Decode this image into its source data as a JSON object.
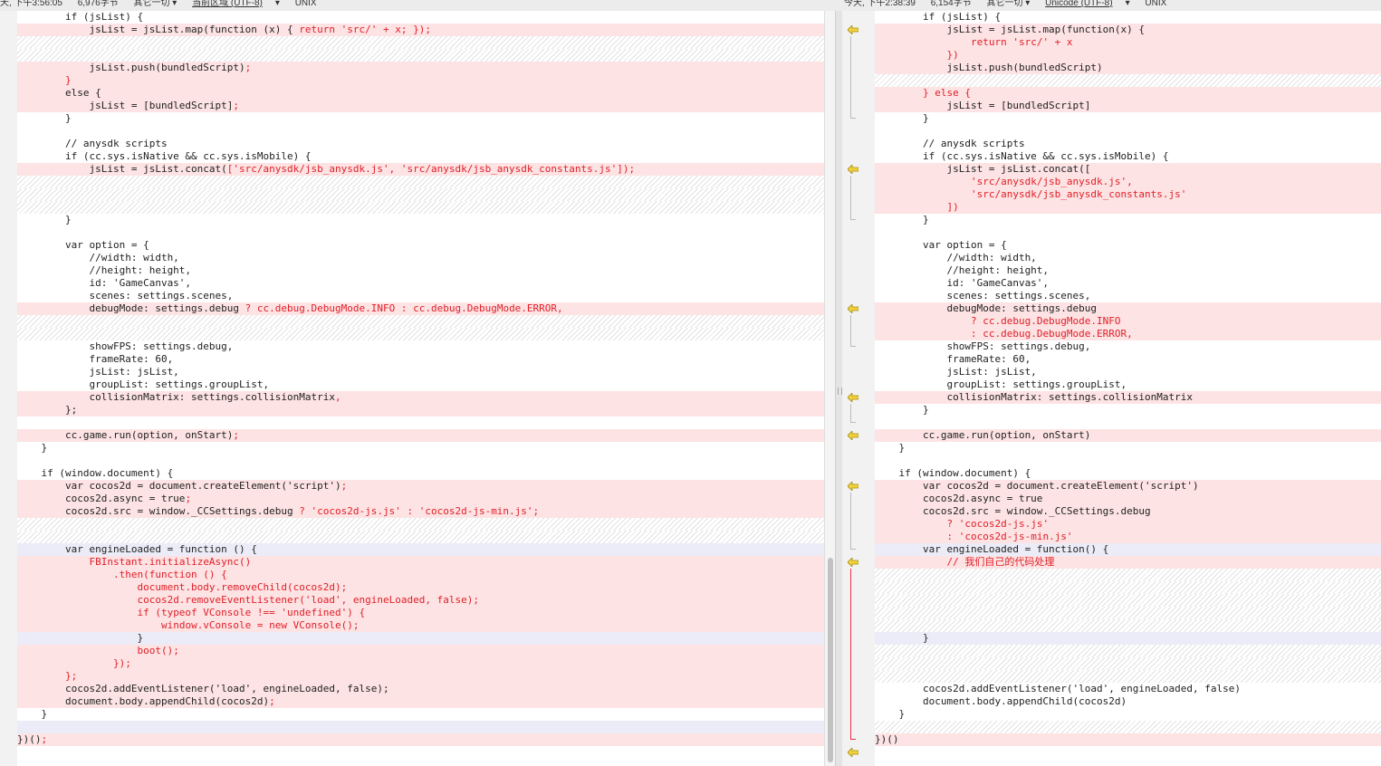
{
  "status_left": {
    "time": "天, 下午3:56:05",
    "chars": "6,976字节",
    "other": "其它一切 ▾",
    "encoding": "当前区域 (UTF-8)",
    "encoding_arrow": "▾",
    "line_ending": "UNIX"
  },
  "status_right": {
    "time": "今天, 下午2:38:39",
    "chars": "6,154字节",
    "other": "其它一切 ▾",
    "encoding": "Unicode (UTF-8)",
    "encoding_arrow": "▾",
    "line_ending": "UNIX"
  },
  "colors": {
    "deleted_bg": "#fde3e3",
    "changed_text": "#e0202a",
    "blue_bg": "#ececf8",
    "arrow": "#f1d23a"
  },
  "icons": {
    "merge_arrow": "merge-left-arrow-icon"
  },
  "left_lines": [
    {
      "t": "n",
      "s": [
        [
          "        if (jsList) {",
          0
        ]
      ]
    },
    {
      "t": "d",
      "s": [
        [
          "            jsList = jsList.map(function (x) { ",
          0
        ],
        [
          "return 'src/' + x; });",
          1
        ]
      ]
    },
    {
      "t": "b",
      "s": []
    },
    {
      "t": "b",
      "s": []
    },
    {
      "t": "d",
      "s": [
        [
          "            jsList.push(bundledScript)",
          0
        ],
        [
          ";",
          1
        ]
      ]
    },
    {
      "t": "d",
      "s": [
        [
          "        ",
          0
        ],
        [
          "}",
          1
        ]
      ]
    },
    {
      "t": "d",
      "s": [
        [
          "        else {",
          0
        ]
      ]
    },
    {
      "t": "d",
      "s": [
        [
          "            jsList = [bundledScript]",
          0
        ],
        [
          ";",
          1
        ]
      ]
    },
    {
      "t": "n",
      "s": [
        [
          "        }",
          0
        ]
      ]
    },
    {
      "t": "n",
      "s": [
        [
          "",
          0
        ]
      ]
    },
    {
      "t": "n",
      "s": [
        [
          "        // anysdk scripts",
          0
        ]
      ]
    },
    {
      "t": "n",
      "s": [
        [
          "        if (cc.sys.isNative && cc.sys.isMobile) {",
          0
        ]
      ]
    },
    {
      "t": "d",
      "s": [
        [
          "            jsList = jsList.concat(",
          0
        ],
        [
          "['src/anysdk/jsb_anysdk.js', 'src/anysdk/jsb_anysdk_constants.js']);",
          1
        ]
      ]
    },
    {
      "t": "b",
      "s": []
    },
    {
      "t": "b",
      "s": []
    },
    {
      "t": "b",
      "s": []
    },
    {
      "t": "n",
      "s": [
        [
          "        }",
          0
        ]
      ]
    },
    {
      "t": "n",
      "s": [
        [
          "",
          0
        ]
      ]
    },
    {
      "t": "n",
      "s": [
        [
          "        var option = {",
          0
        ]
      ]
    },
    {
      "t": "n",
      "s": [
        [
          "            //width: width,",
          0
        ]
      ]
    },
    {
      "t": "n",
      "s": [
        [
          "            //height: height,",
          0
        ]
      ]
    },
    {
      "t": "n",
      "s": [
        [
          "            id: 'GameCanvas',",
          0
        ]
      ]
    },
    {
      "t": "n",
      "s": [
        [
          "            scenes: settings.scenes,",
          0
        ]
      ]
    },
    {
      "t": "d",
      "s": [
        [
          "            debugMode: settings.debug ",
          0
        ],
        [
          "? cc.debug.DebugMode.INFO : cc.debug.DebugMode.ERROR,",
          1
        ]
      ]
    },
    {
      "t": "b",
      "s": []
    },
    {
      "t": "b",
      "s": []
    },
    {
      "t": "n",
      "s": [
        [
          "            showFPS: settings.debug,",
          0
        ]
      ]
    },
    {
      "t": "n",
      "s": [
        [
          "            frameRate: 60,",
          0
        ]
      ]
    },
    {
      "t": "n",
      "s": [
        [
          "            jsList: jsList,",
          0
        ]
      ]
    },
    {
      "t": "n",
      "s": [
        [
          "            groupList: settings.groupList,",
          0
        ]
      ]
    },
    {
      "t": "d",
      "s": [
        [
          "            collisionMatrix: settings.collisionMatrix",
          0
        ],
        [
          ",",
          1
        ]
      ]
    },
    {
      "t": "d",
      "s": [
        [
          "        };",
          0
        ]
      ]
    },
    {
      "t": "n",
      "s": [
        [
          "",
          0
        ]
      ]
    },
    {
      "t": "d",
      "s": [
        [
          "        cc.game.run(option, onStart)",
          0
        ],
        [
          ";",
          1
        ]
      ]
    },
    {
      "t": "n",
      "s": [
        [
          "    }",
          0
        ]
      ]
    },
    {
      "t": "n",
      "s": [
        [
          "",
          0
        ]
      ]
    },
    {
      "t": "n",
      "s": [
        [
          "    if (window.document) {",
          0
        ]
      ]
    },
    {
      "t": "d",
      "s": [
        [
          "        var cocos2d = document.createElement('script')",
          0
        ],
        [
          ";",
          1
        ]
      ]
    },
    {
      "t": "d",
      "s": [
        [
          "        cocos2d.async = true",
          0
        ],
        [
          ";",
          1
        ]
      ]
    },
    {
      "t": "d",
      "s": [
        [
          "        cocos2d.src = window._CCSettings.debug ",
          0
        ],
        [
          "? 'cocos2d-js.js' : 'cocos2d-js-min.js';",
          1
        ]
      ]
    },
    {
      "t": "b",
      "s": []
    },
    {
      "t": "b",
      "s": []
    },
    {
      "t": "u",
      "s": [
        [
          "        var engineLoaded = function () {",
          0
        ]
      ]
    },
    {
      "t": "d",
      "s": [
        [
          "            ",
          0
        ],
        [
          "FBInstant.initializeAsync()",
          1
        ]
      ]
    },
    {
      "t": "d",
      "s": [
        [
          "                ",
          0
        ],
        [
          ".then(function () {",
          1
        ]
      ]
    },
    {
      "t": "d",
      "s": [
        [
          "                    ",
          0
        ],
        [
          "document.body.removeChild(cocos2d);",
          1
        ]
      ]
    },
    {
      "t": "d",
      "s": [
        [
          "                    ",
          0
        ],
        [
          "cocos2d.removeEventListener('load', engineLoaded, false);",
          1
        ]
      ]
    },
    {
      "t": "d",
      "s": [
        [
          "                    ",
          0
        ],
        [
          "if (typeof VConsole !== 'undefined') {",
          1
        ]
      ]
    },
    {
      "t": "d",
      "s": [
        [
          "                        ",
          0
        ],
        [
          "window.vConsole = new VConsole();",
          1
        ]
      ]
    },
    {
      "t": "u",
      "s": [
        [
          "                    }",
          0
        ]
      ]
    },
    {
      "t": "d",
      "s": [
        [
          "                    ",
          0
        ],
        [
          "boot();",
          1
        ]
      ]
    },
    {
      "t": "d",
      "s": [
        [
          "                ",
          0
        ],
        [
          "});",
          1
        ]
      ]
    },
    {
      "t": "d",
      "s": [
        [
          "        ",
          0
        ],
        [
          "};",
          1
        ]
      ]
    },
    {
      "t": "d",
      "s": [
        [
          "        cocos2d.addEventListener('load', engineLoaded, false);",
          0
        ]
      ]
    },
    {
      "t": "d",
      "s": [
        [
          "        document.body.appendChild(cocos2d)",
          0
        ],
        [
          ";",
          1
        ]
      ]
    },
    {
      "t": "n",
      "s": [
        [
          "    }",
          0
        ]
      ]
    },
    {
      "t": "u",
      "s": [
        [
          "",
          0
        ]
      ]
    },
    {
      "t": "d",
      "s": [
        [
          "})()",
          0
        ],
        [
          ";",
          1
        ]
      ]
    },
    {
      "t": "n",
      "s": [
        [
          "",
          0
        ]
      ]
    }
  ],
  "right_lines": [
    {
      "t": "n",
      "s": [
        [
          "        if (jsList) {",
          0
        ]
      ]
    },
    {
      "t": "d",
      "s": [
        [
          "            jsList = jsList.map(function(x) {",
          0
        ]
      ]
    },
    {
      "t": "d",
      "s": [
        [
          "                ",
          0
        ],
        [
          "return 'src/' + x",
          1
        ]
      ]
    },
    {
      "t": "d",
      "s": [
        [
          "            ",
          0
        ],
        [
          "})",
          1
        ]
      ]
    },
    {
      "t": "d",
      "s": [
        [
          "            jsList.push(bundledScript)",
          0
        ]
      ]
    },
    {
      "t": "b",
      "s": []
    },
    {
      "t": "d",
      "s": [
        [
          "        ",
          0
        ],
        [
          "} else {",
          1
        ]
      ]
    },
    {
      "t": "d",
      "s": [
        [
          "            jsList = [bundledScript]",
          0
        ]
      ]
    },
    {
      "t": "n",
      "s": [
        [
          "        }",
          0
        ]
      ]
    },
    {
      "t": "n",
      "s": [
        [
          "",
          0
        ]
      ]
    },
    {
      "t": "n",
      "s": [
        [
          "        // anysdk scripts",
          0
        ]
      ]
    },
    {
      "t": "n",
      "s": [
        [
          "        if (cc.sys.isNative && cc.sys.isMobile) {",
          0
        ]
      ]
    },
    {
      "t": "d",
      "s": [
        [
          "            jsList = jsList.concat([",
          0
        ]
      ]
    },
    {
      "t": "d",
      "s": [
        [
          "                ",
          0
        ],
        [
          "'src/anysdk/jsb_anysdk.js',",
          1
        ]
      ]
    },
    {
      "t": "d",
      "s": [
        [
          "                ",
          0
        ],
        [
          "'src/anysdk/jsb_anysdk_constants.js'",
          1
        ]
      ]
    },
    {
      "t": "d",
      "s": [
        [
          "            ",
          0
        ],
        [
          "])",
          1
        ]
      ]
    },
    {
      "t": "n",
      "s": [
        [
          "        }",
          0
        ]
      ]
    },
    {
      "t": "n",
      "s": [
        [
          "",
          0
        ]
      ]
    },
    {
      "t": "n",
      "s": [
        [
          "        var option = {",
          0
        ]
      ]
    },
    {
      "t": "n",
      "s": [
        [
          "            //width: width,",
          0
        ]
      ]
    },
    {
      "t": "n",
      "s": [
        [
          "            //height: height,",
          0
        ]
      ]
    },
    {
      "t": "n",
      "s": [
        [
          "            id: 'GameCanvas',",
          0
        ]
      ]
    },
    {
      "t": "n",
      "s": [
        [
          "            scenes: settings.scenes,",
          0
        ]
      ]
    },
    {
      "t": "d",
      "s": [
        [
          "            debugMode: settings.debug",
          0
        ]
      ]
    },
    {
      "t": "d",
      "s": [
        [
          "                ",
          0
        ],
        [
          "? cc.debug.DebugMode.INFO",
          1
        ]
      ]
    },
    {
      "t": "d",
      "s": [
        [
          "                ",
          0
        ],
        [
          ": cc.debug.DebugMode.ERROR,",
          1
        ]
      ]
    },
    {
      "t": "n",
      "s": [
        [
          "            showFPS: settings.debug,",
          0
        ]
      ]
    },
    {
      "t": "n",
      "s": [
        [
          "            frameRate: 60,",
          0
        ]
      ]
    },
    {
      "t": "n",
      "s": [
        [
          "            jsList: jsList,",
          0
        ]
      ]
    },
    {
      "t": "n",
      "s": [
        [
          "            groupList: settings.groupList,",
          0
        ]
      ]
    },
    {
      "t": "d",
      "s": [
        [
          "            collisionMatrix: settings.collisionMatrix",
          0
        ]
      ]
    },
    {
      "t": "n",
      "s": [
        [
          "        }",
          0
        ]
      ]
    },
    {
      "t": "n",
      "s": [
        [
          "",
          0
        ]
      ]
    },
    {
      "t": "d",
      "s": [
        [
          "        cc.game.run(option, onStart)",
          0
        ]
      ]
    },
    {
      "t": "n",
      "s": [
        [
          "    }",
          0
        ]
      ]
    },
    {
      "t": "n",
      "s": [
        [
          "",
          0
        ]
      ]
    },
    {
      "t": "n",
      "s": [
        [
          "    if (window.document) {",
          0
        ]
      ]
    },
    {
      "t": "d",
      "s": [
        [
          "        var cocos2d = document.createElement('script')",
          0
        ]
      ]
    },
    {
      "t": "d",
      "s": [
        [
          "        cocos2d.async = true",
          0
        ]
      ]
    },
    {
      "t": "d",
      "s": [
        [
          "        cocos2d.src = window._CCSettings.debug",
          0
        ]
      ]
    },
    {
      "t": "d",
      "s": [
        [
          "            ",
          0
        ],
        [
          "? 'cocos2d-js.js'",
          1
        ]
      ]
    },
    {
      "t": "d",
      "s": [
        [
          "            ",
          0
        ],
        [
          ": 'cocos2d-js-min.js'",
          1
        ]
      ]
    },
    {
      "t": "u",
      "s": [
        [
          "        var engineLoaded = function() {",
          0
        ]
      ]
    },
    {
      "t": "d",
      "s": [
        [
          "            ",
          0
        ],
        [
          "// 我们自己的代码处理",
          1
        ]
      ]
    },
    {
      "t": "b",
      "s": []
    },
    {
      "t": "b",
      "s": []
    },
    {
      "t": "b",
      "s": []
    },
    {
      "t": "b",
      "s": []
    },
    {
      "t": "b",
      "s": []
    },
    {
      "t": "u",
      "s": [
        [
          "        }",
          0
        ]
      ]
    },
    {
      "t": "b",
      "s": []
    },
    {
      "t": "b",
      "s": []
    },
    {
      "t": "b",
      "s": []
    },
    {
      "t": "n",
      "s": [
        [
          "        cocos2d.addEventListener('load', engineLoaded, false)",
          0
        ]
      ]
    },
    {
      "t": "n",
      "s": [
        [
          "        document.body.appendChild(cocos2d)",
          0
        ]
      ]
    },
    {
      "t": "n",
      "s": [
        [
          "    }",
          0
        ]
      ]
    },
    {
      "t": "b",
      "s": []
    },
    {
      "t": "d",
      "s": [
        [
          "})()",
          0
        ]
      ]
    },
    {
      "t": "n",
      "s": [
        [
          "",
          0
        ]
      ]
    }
  ],
  "merge_arrow_rows": [
    1,
    12,
    23,
    30,
    33,
    37,
    43,
    58
  ]
}
